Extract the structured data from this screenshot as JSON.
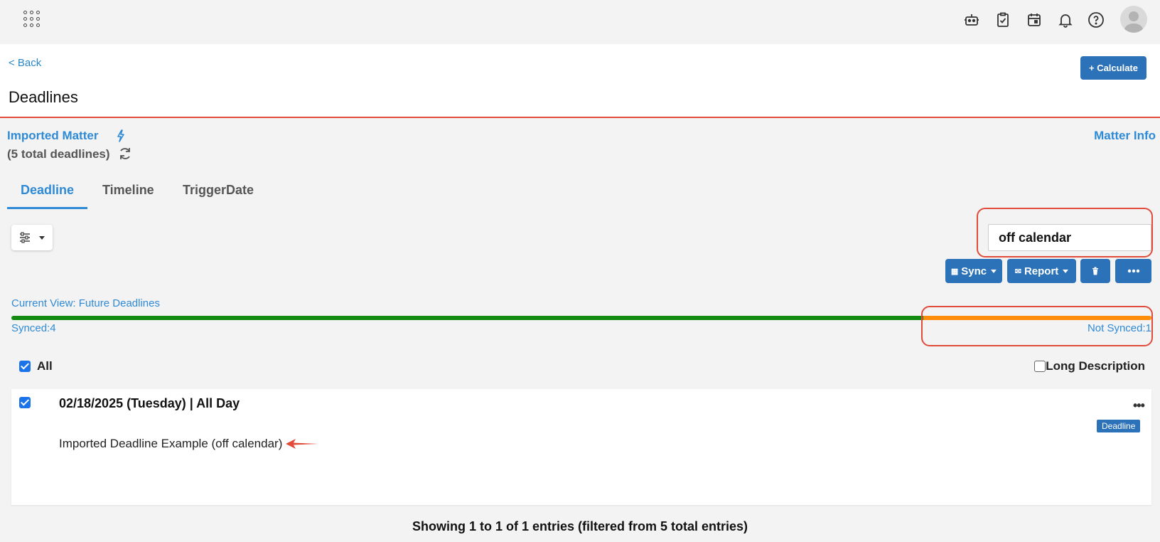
{
  "topbar": {
    "icons": [
      "apps-grid-icon",
      "robot-icon",
      "clipboard-check-icon",
      "calendar-icon",
      "bell-icon",
      "help-icon",
      "user-avatar"
    ]
  },
  "header": {
    "back_label": "< Back",
    "title": "Deadlines",
    "calculate_label": "+ Calculate"
  },
  "matter": {
    "name": "Imported Matter",
    "count_label": "(5 total deadlines)",
    "info_label": "Matter Info"
  },
  "tabs": [
    {
      "label": "Deadline",
      "active": true
    },
    {
      "label": "Timeline",
      "active": false
    },
    {
      "label": "TriggerDate",
      "active": false
    }
  ],
  "search": {
    "value": "off calendar"
  },
  "actions": {
    "sync_label": "Sync",
    "report_label": "Report"
  },
  "status": {
    "current_view": "Current View: Future Deadlines",
    "synced_label": "Synced:4",
    "not_synced_label": "Not Synced:1",
    "synced_count": 4,
    "not_synced_count": 1,
    "synced_color": "#138a12",
    "not_synced_color": "#ff8c0a"
  },
  "list_controls": {
    "all_label": "All",
    "all_checked": true,
    "long_description_label": "Long Description",
    "long_description_checked": false
  },
  "deadlines": [
    {
      "date": "02/18/2025 (Tuesday)  |  All Day",
      "description": "Imported Deadline Example (off calendar)",
      "badge": "Deadline",
      "checked": true
    }
  ],
  "footer": {
    "info": "Showing 1 to 1 of 1 entries (filtered from 5 total entries)"
  },
  "colors": {
    "accent": "#2f8ad6",
    "button": "#2b72b8",
    "annotation": "#e04b3a"
  }
}
